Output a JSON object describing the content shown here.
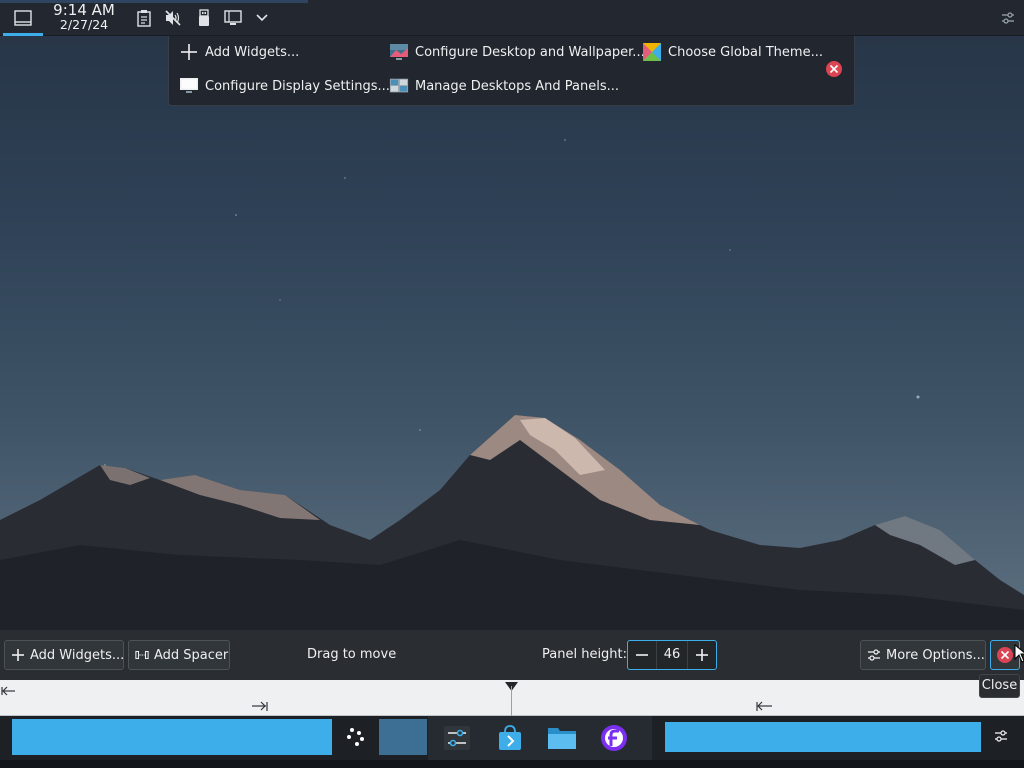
{
  "top_panel": {
    "clock_time": "9:14 AM",
    "clock_date": "2/27/24",
    "icons": [
      "show-desktop-icon",
      "clipboard-icon",
      "audio-muted-icon",
      "usb-icon",
      "display-icon",
      "chevron-down-icon",
      "panel-config-icon"
    ]
  },
  "toolbox": {
    "add_widgets": "Add Widgets...",
    "configure_desktop": "Configure Desktop and Wallpaper...",
    "choose_theme": "Choose Global Theme...",
    "display_settings": "Configure Display Settings...",
    "manage_desktops": "Manage Desktops And Panels..."
  },
  "edit_bar": {
    "add_widgets": "Add Widgets...",
    "add_spacer": "Add Spacer",
    "drag_label": "Drag to move",
    "panel_height_label": "Panel height:",
    "panel_height_value": "46",
    "more_options": "More Options...",
    "close_tooltip": "Close"
  },
  "bottom_panel": {
    "tasks": [
      "system-settings-icon",
      "discover-store-icon",
      "dolphin-folder-icon",
      "fedora-icon"
    ]
  },
  "colors": {
    "accent": "#3daee9",
    "close_red": "#da4453",
    "panel_bg": "#232830"
  }
}
